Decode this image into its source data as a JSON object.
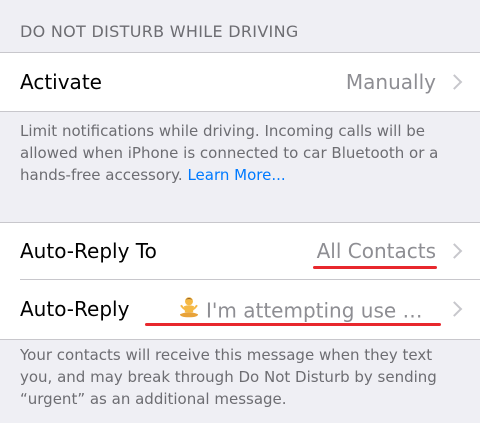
{
  "section": {
    "title": "DO NOT DISTURB WHILE DRIVING"
  },
  "activate": {
    "label": "Activate",
    "value": "Manually"
  },
  "activate_footer": {
    "text": "Limit notifications while driving. Incoming calls will be allowed when iPhone is connected to car Bluetooth or a hands-free accessory. ",
    "link": "Learn More..."
  },
  "auto_reply_to": {
    "label": "Auto-Reply To",
    "value": "All Contacts"
  },
  "auto_reply": {
    "label": "Auto-Reply",
    "value": "I'm attempting use my p...",
    "emoji": "person-in-lotus-position-icon"
  },
  "auto_reply_footer": {
    "text": "Your contacts will receive this message when they text you, and may break through Do Not Disturb by sending “urgent” as an additional message."
  },
  "colors": {
    "background": "#efeff4",
    "cell": "#ffffff",
    "secondary_text": "#8e8e93",
    "footer_text": "#6d6d72",
    "link": "#007aff",
    "annotation_underline": "#e8282d"
  }
}
